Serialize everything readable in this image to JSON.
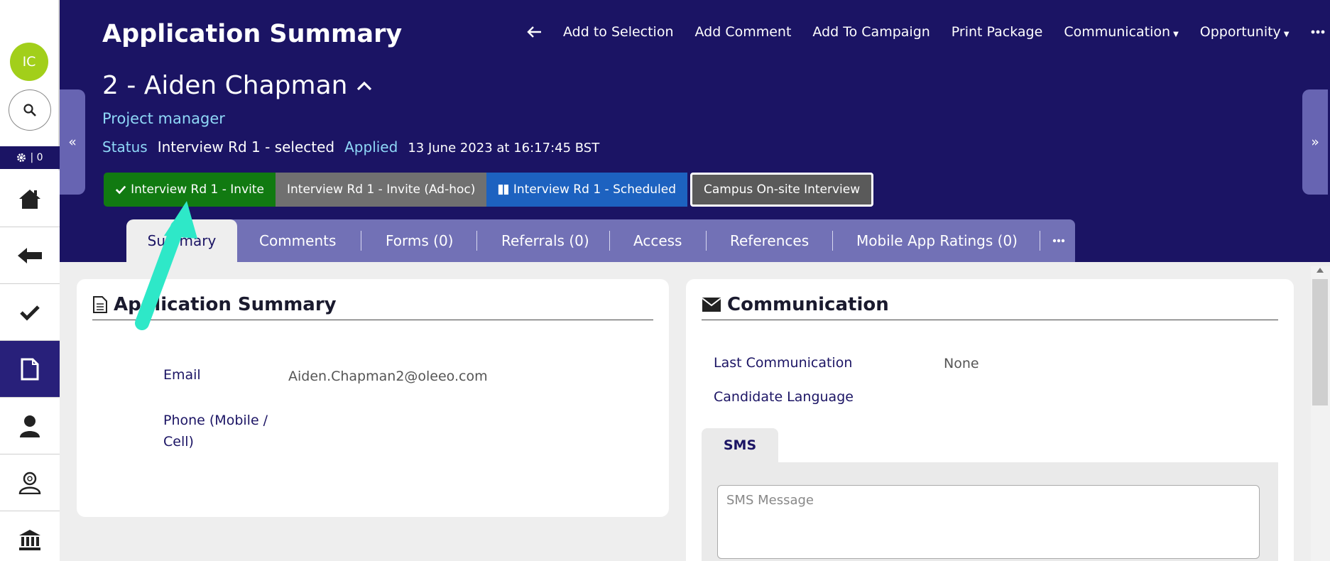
{
  "sidebar": {
    "avatar_initials": "IC",
    "gear_count": "| 0",
    "items": [
      "home-icon",
      "back-arrow-icon",
      "check-icon",
      "document-icon",
      "person-icon",
      "person-search-icon",
      "bank-icon"
    ]
  },
  "header": {
    "title": "Application Summary",
    "actions": [
      "Add to Selection",
      "Add Comment",
      "Add To Campaign",
      "Print Package",
      "Communication",
      "Opportunity"
    ],
    "left_arrow": "«",
    "right_arrow": "»"
  },
  "candidate": {
    "name": "2 - Aiden Chapman",
    "job_title": "Project manager",
    "status_label": "Status",
    "status_value": "Interview Rd 1 - selected",
    "applied_label": "Applied",
    "applied_date": "13 June 2023 at 16:17:45 BST"
  },
  "stages": [
    "Interview Rd 1 - Invite",
    "Interview Rd 1 - Invite (Ad-hoc)",
    "Interview Rd 1 - Scheduled",
    "Campus On-site Interview"
  ],
  "tabs": [
    "Summary",
    "Comments",
    "Forms (0)",
    "Referrals (0)",
    "Access",
    "References",
    "Mobile App Ratings (0)"
  ],
  "summary_card": {
    "title": "Application Summary",
    "email_label": "Email",
    "email_value": "Aiden.Chapman2@oleeo.com",
    "phone_label_1": "Phone (Mobile /",
    "phone_label_2": "Cell)"
  },
  "communication_card": {
    "title": "Communication",
    "last_comm_label": "Last Communication",
    "last_comm_value": "None",
    "language_label": "Candidate Language",
    "sms_tab": "SMS",
    "sms_placeholder": "SMS Message"
  },
  "colors": {
    "header_bg": "#1b1464",
    "stage_green": "#117a11",
    "stage_grey": "#707070",
    "stage_blue": "#1d62c0",
    "annotation_arrow": "#2ee8c8"
  }
}
